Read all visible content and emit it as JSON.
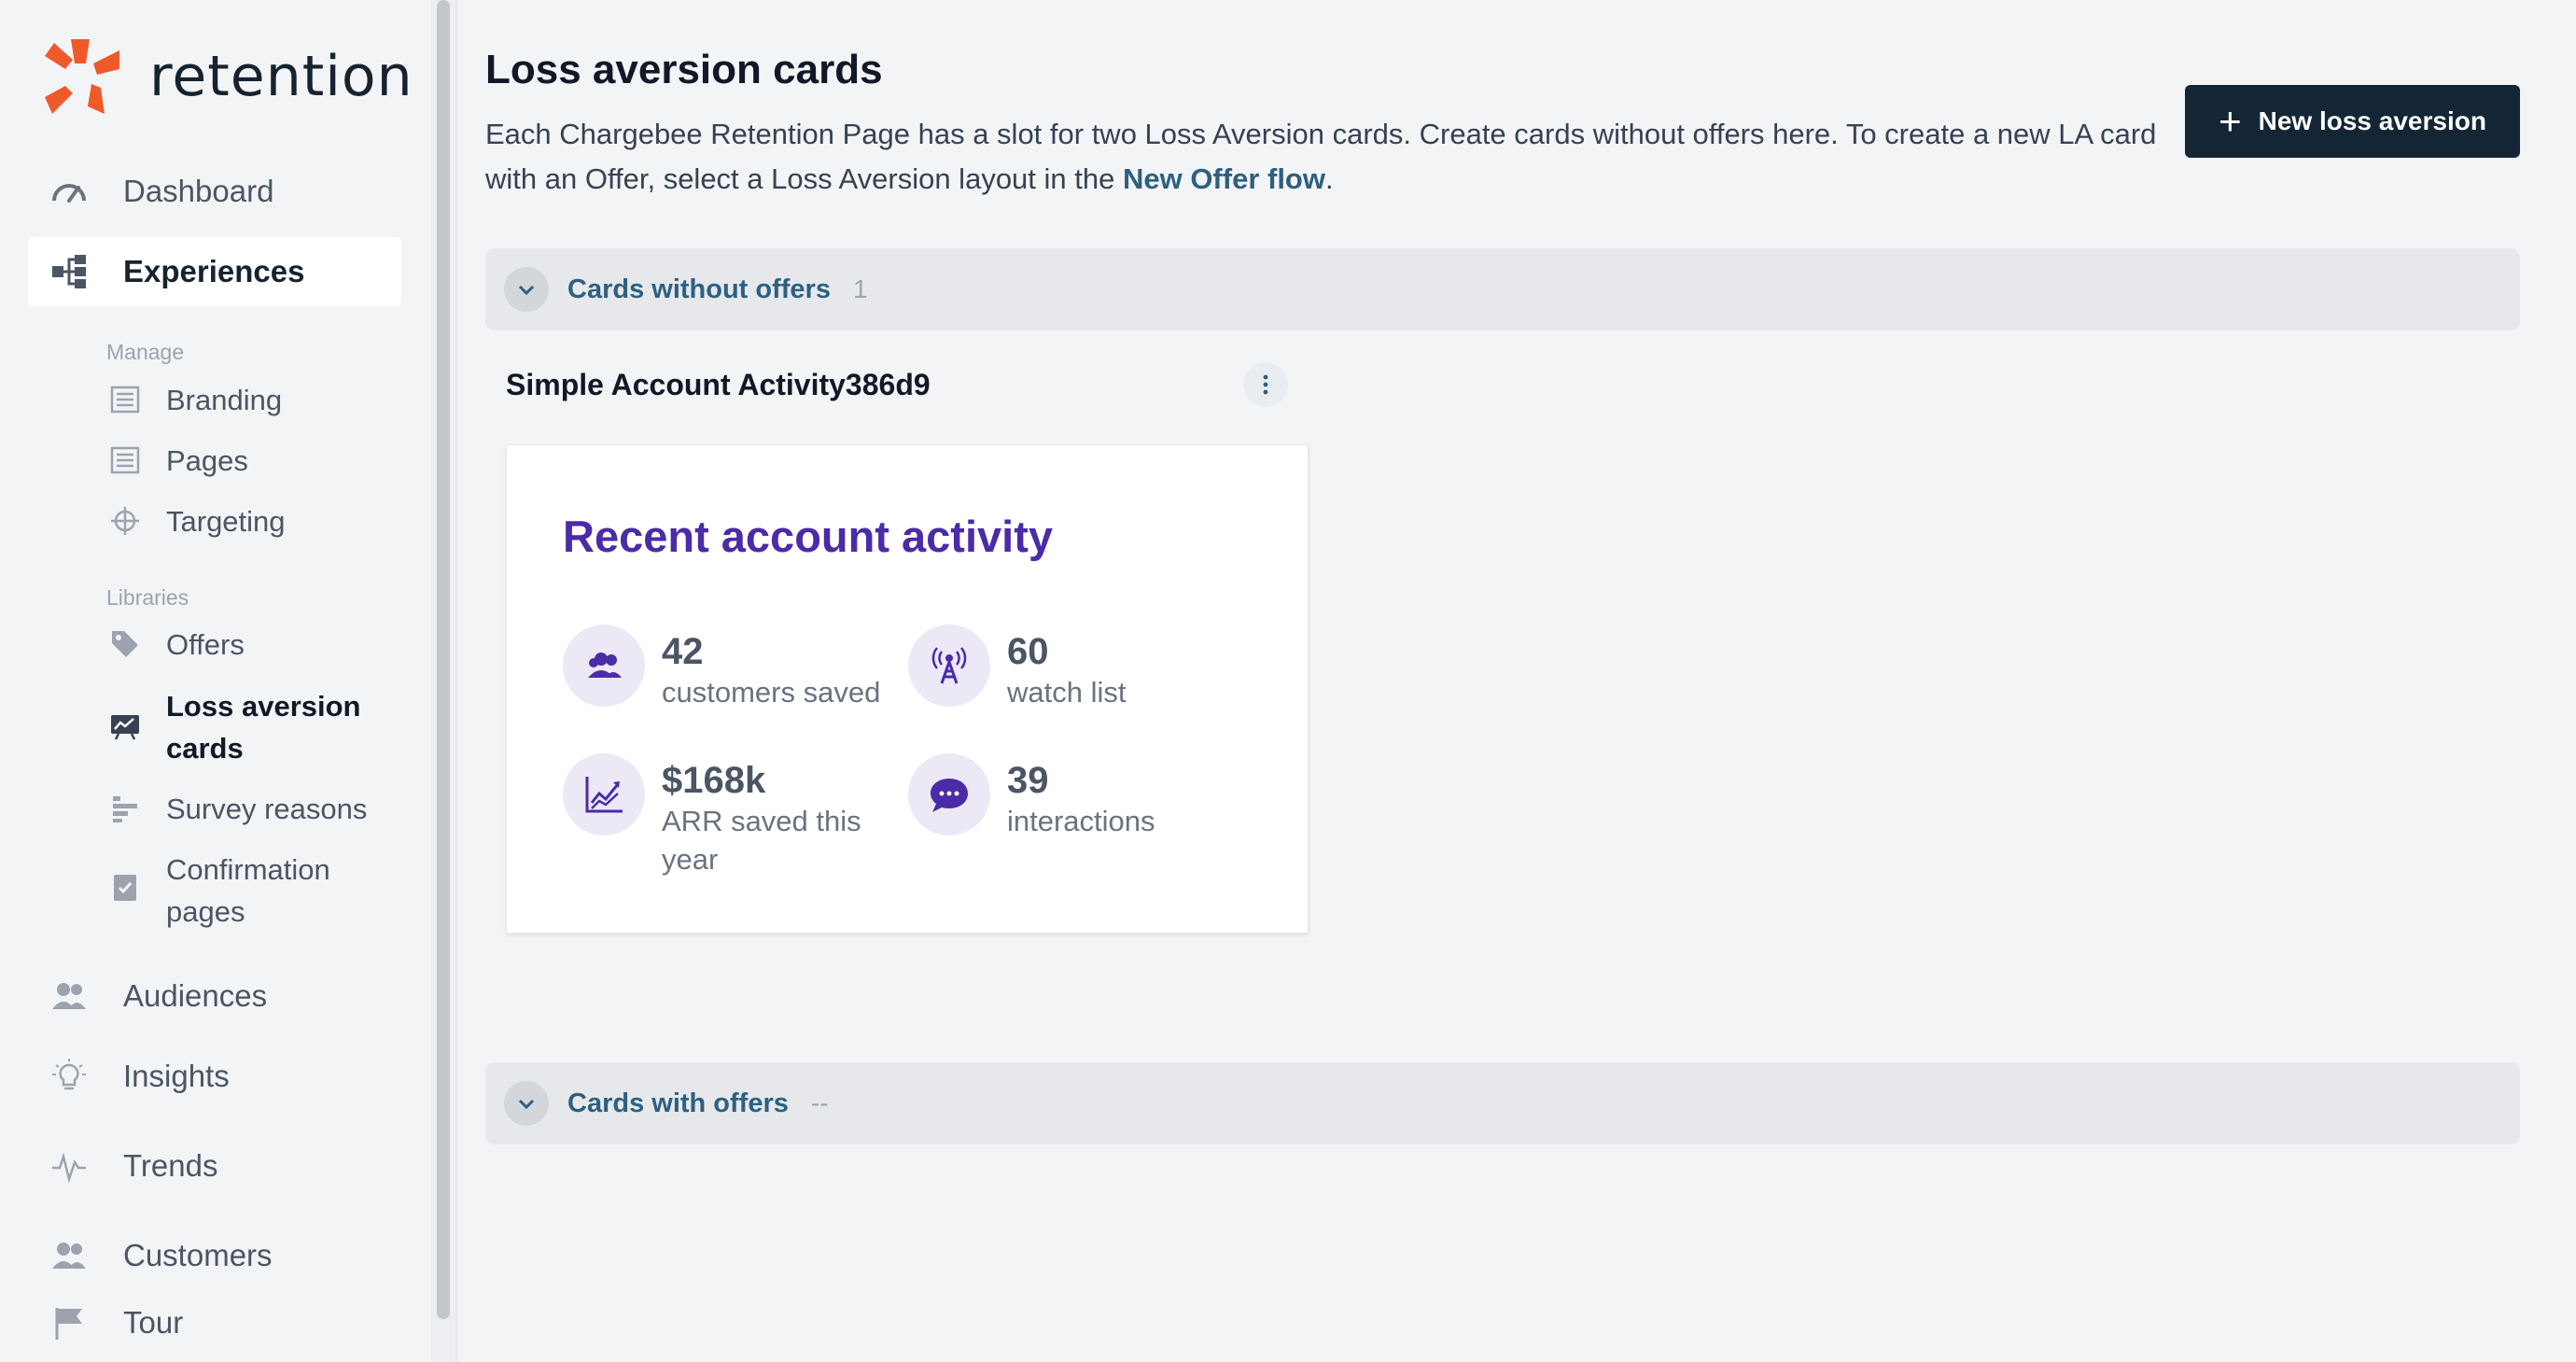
{
  "brand": {
    "name": "retention",
    "accent": "#ef5a2a"
  },
  "sidebar": {
    "top_items": [
      {
        "label": "Dashboard",
        "icon": "gauge-icon"
      },
      {
        "label": "Experiences",
        "icon": "flow-tree-icon",
        "active": true
      }
    ],
    "manage": {
      "title": "Manage",
      "items": [
        {
          "label": "Branding",
          "icon": "document-lines-icon"
        },
        {
          "label": "Pages",
          "icon": "document-lines-icon"
        },
        {
          "label": "Targeting",
          "icon": "crosshair-icon"
        }
      ]
    },
    "libraries": {
      "title": "Libraries",
      "items": [
        {
          "label": "Offers",
          "icon": "tag-icon"
        },
        {
          "label": "Loss aversion cards",
          "icon": "chart-card-icon",
          "active": true
        },
        {
          "label": "Survey reasons",
          "icon": "bars-list-icon"
        },
        {
          "label": "Confirmation pages",
          "icon": "check-document-icon"
        }
      ]
    },
    "bottom_items": [
      {
        "label": "Audiences",
        "icon": "users-icon"
      },
      {
        "label": "Insights",
        "icon": "lightbulb-icon"
      },
      {
        "label": "Trends",
        "icon": "pulse-icon"
      },
      {
        "label": "Customers",
        "icon": "users-icon"
      },
      {
        "label": "Tour",
        "icon": "flag-icon"
      }
    ]
  },
  "main": {
    "title": "Loss aversion cards",
    "description_prefix": "Each Chargebee Retention Page has a slot for two Loss Aversion cards. Create cards without offers here. To create a new LA card with an Offer, select a Loss Aversion layout in the ",
    "description_link": "New Offer flow",
    "description_suffix": ".",
    "new_button_label": "New loss aversion",
    "sections": [
      {
        "title": "Cards without offers",
        "count": "1"
      },
      {
        "title": "Cards with offers",
        "count": "--"
      }
    ],
    "card": {
      "name": "Simple Account Activity386d9",
      "preview_title": "Recent account activity",
      "stats": [
        {
          "value": "42",
          "label": "customers saved",
          "icon": "users-icon"
        },
        {
          "value": "60",
          "label": "watch list",
          "icon": "broadcast-tower-icon"
        },
        {
          "value": "$168k",
          "label": "ARR saved this year",
          "icon": "chart-line-icon"
        },
        {
          "value": "39",
          "label": "interactions",
          "icon": "chat-bubble-icon"
        }
      ]
    }
  }
}
